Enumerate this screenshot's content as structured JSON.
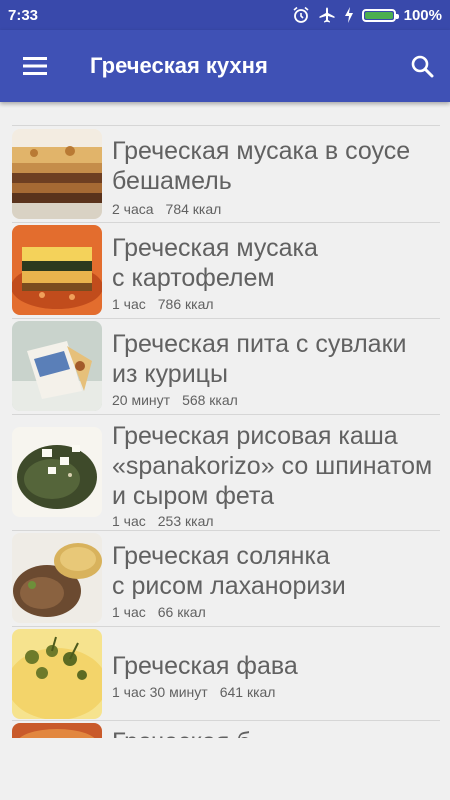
{
  "status": {
    "time": "7:33",
    "battery": "100%",
    "battery_level": 1.0
  },
  "appbar": {
    "title": "Греческая кухня"
  },
  "recipes": [
    {
      "title_l1": "Греческая мусака в соусе",
      "title_l2": "бешамель",
      "time": "2 часа",
      "kcal": "784 ккал"
    },
    {
      "title_l1": "Греческая мусака",
      "title_l2": "с картофелем",
      "time": "1 час",
      "kcal": "786 ккал"
    },
    {
      "title_l1": "Греческая пита с сувлаки",
      "title_l2": "из курицы",
      "time": "20 минут",
      "kcal": "568 ккал"
    },
    {
      "title_l1": "Греческая рисовая каша",
      "title_l2": "«spanakorizo» со шпинатом",
      "title_l3": "и сыром фета",
      "time": "1 час",
      "kcal": "253 ккал"
    },
    {
      "title_l1": "Греческая солянка",
      "title_l2": "с рисом лаханоризи",
      "time": "1 час",
      "kcal": "66 ккал"
    },
    {
      "title_l1": "Греческая фава",
      "time": "1 час 30 минут",
      "kcal": "641 ккал"
    }
  ],
  "partial_next_title": "Греческая б..."
}
